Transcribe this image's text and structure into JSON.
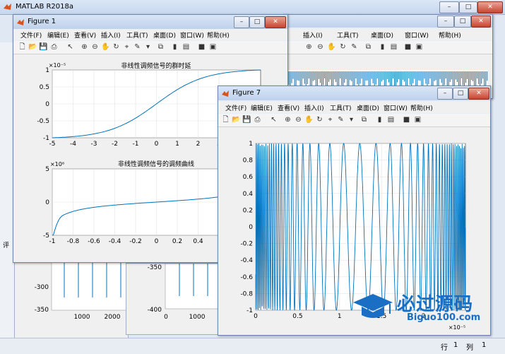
{
  "app": {
    "title": "MATLAB R2018a"
  },
  "status": {
    "row_label": "行",
    "row_value": "1",
    "col_label": "列",
    "col_value": "1"
  },
  "bg_figures": {
    "left_ticks_y": [
      "-300",
      "-350"
    ],
    "left_ticks_x": [
      "1000",
      "2000"
    ],
    "mid_ticks_y": [
      "-350",
      "-400"
    ],
    "mid_ticks_x": [
      "0",
      "1000"
    ],
    "left_edge_label": "评"
  },
  "figure1": {
    "title": "Figure 1",
    "menu": [
      "文件(F)",
      "编辑(E)",
      "查看(V)",
      "插入(I)",
      "工具(T)",
      "桌面(D)",
      "窗口(W)",
      "帮助(H)"
    ],
    "plot1": {
      "title": "非线性调频信号的群时延",
      "exponent": "×10⁻⁵",
      "yticks": [
        "1",
        "0.5",
        "0",
        "-0.5",
        "-1"
      ],
      "xticks": [
        "-5",
        "-4",
        "-3",
        "-2",
        "-1",
        "0",
        "1",
        "2",
        "3"
      ]
    },
    "plot2": {
      "title": "非线性调频信号的调频曲线",
      "exponent": "×10⁶",
      "yticks": [
        "5",
        "0",
        "-5"
      ],
      "xticks": [
        "-1",
        "-0.8",
        "-0.6",
        "-0.4",
        "-0.2",
        "0",
        "0.2",
        "0.4"
      ]
    }
  },
  "figure7": {
    "title": "Figure 7",
    "menu": [
      "文件(F)",
      "编辑(E)",
      "查看(V)",
      "插入(I)",
      "工具(T)",
      "桌面(D)",
      "窗口(W)",
      "帮助(H)"
    ],
    "exponent": "×10⁻⁵",
    "yticks": [
      "1",
      "0.8",
      "0.6",
      "0.4",
      "0.2",
      "0",
      "-0.2",
      "-0.4",
      "-0.6",
      "-0.8",
      "-1"
    ],
    "xticks": [
      "0",
      "0.5",
      "1",
      "1.5",
      "2"
    ]
  },
  "back_figure": {
    "menu": [
      "插入(I)",
      "工具(T)",
      "桌面(D)",
      "窗口(W)",
      "帮助(H)"
    ]
  },
  "watermark": {
    "brand": "必过源码",
    "url": "Biguo100.com"
  },
  "colors": {
    "plot_line": "#0072BD",
    "title_bar": "#c6d7ee",
    "close_button": "#c8432f"
  },
  "chart_data": [
    {
      "type": "line",
      "title": "非线性调频信号的群时延",
      "x_range": [
        -5,
        4
      ],
      "ylim": [
        -1,
        1
      ],
      "y_scale_exponent": "1e-5",
      "x": [
        -5,
        -4,
        -3,
        -2,
        -1,
        0,
        1,
        2,
        3,
        4
      ],
      "y": [
        -1,
        -0.97,
        -0.85,
        -0.6,
        -0.3,
        0,
        0.3,
        0.6,
        0.9,
        1.0
      ],
      "grid": true
    },
    {
      "type": "line",
      "title": "非线性调频信号的调频曲线",
      "xlim": [
        -1,
        1
      ],
      "ylim": [
        -5,
        5
      ],
      "y_scale_exponent": "1e6",
      "x": [
        -1,
        -0.99,
        -0.95,
        -0.8,
        -0.5,
        0,
        0.5,
        0.8
      ],
      "y": [
        -5,
        -2.5,
        -1.7,
        -1.2,
        -0.7,
        0,
        0.6,
        1.1
      ],
      "grid": true
    },
    {
      "type": "line",
      "xlim": [
        0,
        2.5
      ],
      "ylim": [
        -1,
        1
      ],
      "x_scale_exponent": "1e-5",
      "description_series": "cos(phase) non-linear FM signal, dense oscillation at ends, slow near center",
      "grid": true
    }
  ]
}
